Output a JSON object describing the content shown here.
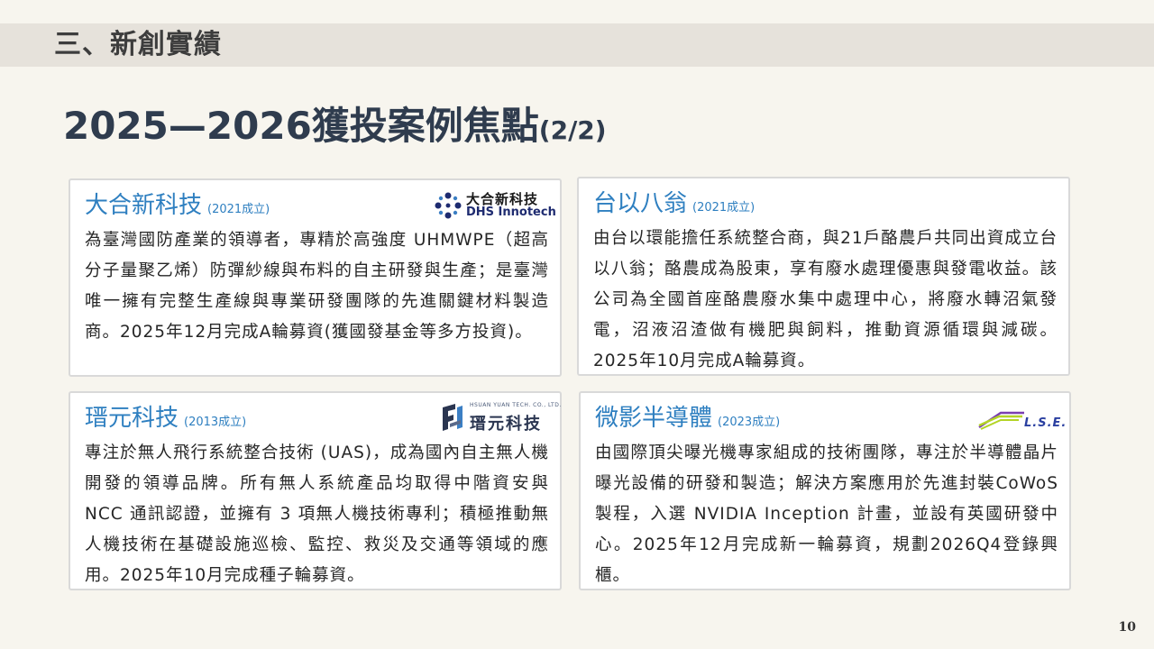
{
  "section": {
    "title": "三、新創實績"
  },
  "main_title": {
    "text": "2025—2026獲投案例焦點",
    "suffix": "(2/2)"
  },
  "cards": [
    {
      "name": "大合新科技",
      "founded": "(2021成立)",
      "body": "為臺灣國防產業的領導者，專精於高強度 UHMWPE（超高分子量聚乙烯）防彈紗線與布料的自主研發與生產；是臺灣唯一擁有完整生產線與專業研發團隊的先進關鍵材料製造商。2025年12月完成A輪募資(獲國發基金等多方投資)。",
      "logo": {
        "zh": "大合新科技",
        "en": "DHS Innotech",
        "icon": "dhs-logo-icon"
      }
    },
    {
      "name": "台以八翁",
      "founded": "(2021成立)",
      "body": "由台以環能擔任系統整合商，與21戶酪農戶共同出資成立台以八翁；酪農成為股東，享有廢水處理優惠與發電收益。該公司為全國首座酪農廢水集中處理中心，將廢水轉沼氣發電，沼液沼渣做有機肥與飼料，推動資源循環與減碳。2025年10月完成A輪募資。"
    },
    {
      "name": "瑨元科技",
      "founded": "(2013成立)",
      "body": "專注於無人飛行系統整合技術 (UAS)，成為國內自主無人機開發的領導品牌。所有無人系統產品均取得中階資安與 NCC 通訊認證，並擁有 3 項無人機技術專利；積極推動無人機技術在基礎設施巡檢、監控、救災及交通等領域的應用。2025年10月完成種子輪募資。",
      "logo": {
        "zh": "瑨元科技",
        "en": "HSUAN YUAN TECH. CO., LTD.",
        "icon": "hy-logo-icon"
      }
    },
    {
      "name": "微影半導體",
      "founded": "(2023成立)",
      "body": "由國際頂尖曝光機專家組成的技術團隊，專注於半導體晶片曝光設備的研發和製造；解決方案應用於先進封裝CoWoS製程，入選 NVIDIA Inception 計畫，並設有英國研發中心。2025年12月完成新一輪募資，規劃2026Q4登錄興櫃。",
      "logo": {
        "text": "L.S.E.",
        "icon": "lse-logo-icon"
      }
    }
  ],
  "page_number": "10",
  "colors": {
    "accent": "#2e7fc0",
    "title": "#2f3c4e",
    "bar": "#e6e2db",
    "background": "#f7f5ee"
  }
}
